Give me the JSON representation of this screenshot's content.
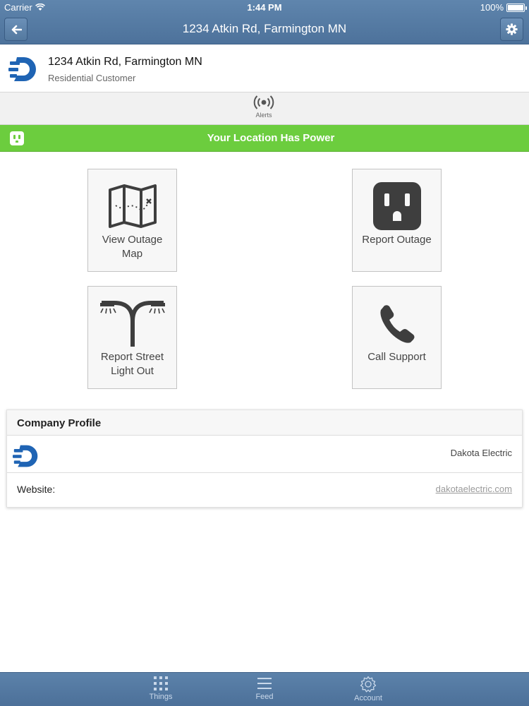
{
  "status_bar": {
    "carrier": "Carrier",
    "time": "1:44 PM",
    "battery": "100%"
  },
  "nav": {
    "title": "1234 Atkin Rd, Farmington MN",
    "back_icon": "arrow-left-icon",
    "settings_icon": "gear-icon"
  },
  "location": {
    "address": "1234 Atkin Rd, Farmington MN",
    "customer_type": "Residential Customer"
  },
  "alerts_tab": {
    "label": "Alerts",
    "icon": "broadcast-icon"
  },
  "power_banner": {
    "text": "Your Location Has Power",
    "color": "#6ccd3e",
    "icon": "outlet-icon"
  },
  "actions": [
    {
      "label": "View Outage Map",
      "icon": "map-icon"
    },
    {
      "label": "Report Outage",
      "icon": "outlet-icon"
    },
    {
      "label": "Report Street Light Out",
      "icon": "street-light-icon"
    },
    {
      "label": "Call Support",
      "icon": "phone-icon"
    }
  ],
  "company_profile": {
    "heading": "Company Profile",
    "company_name": "Dakota Electric",
    "website_label": "Website:",
    "website_value": "dakotaelectric.com"
  },
  "tabbar": {
    "items": [
      {
        "label": "Things",
        "icon": "grid-icon"
      },
      {
        "label": "Feed",
        "icon": "menu-icon"
      },
      {
        "label": "Account",
        "icon": "gear-icon"
      }
    ]
  },
  "colors": {
    "nav_blue": "#5f85ad",
    "brand_blue": "#1f64b4",
    "power_green": "#6ccd3e"
  }
}
